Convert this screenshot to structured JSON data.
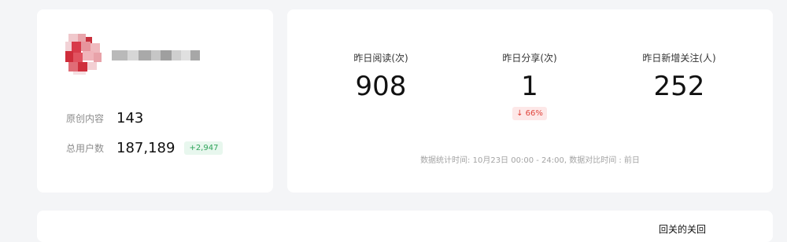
{
  "profile": {
    "original_content": {
      "label": "原创内容",
      "value": "143"
    },
    "total_users": {
      "label": "总用户数",
      "value": "187,189",
      "delta": "+2,947"
    }
  },
  "stats": {
    "reads": {
      "label": "昨日阅读(次)",
      "value": "908"
    },
    "shares": {
      "label": "昨日分享(次)",
      "value": "1",
      "change": "↓ 66%"
    },
    "follows": {
      "label": "昨日新增关注(人)",
      "value": "252"
    },
    "note": "数据统计时间: 10月23日 00:00 - 24:00, 数据对比时间 : 前日"
  },
  "bottom": {
    "corner_text": "回关的关回"
  },
  "colors": {
    "positive": "#2fa35a",
    "negative": "#e0443b"
  }
}
